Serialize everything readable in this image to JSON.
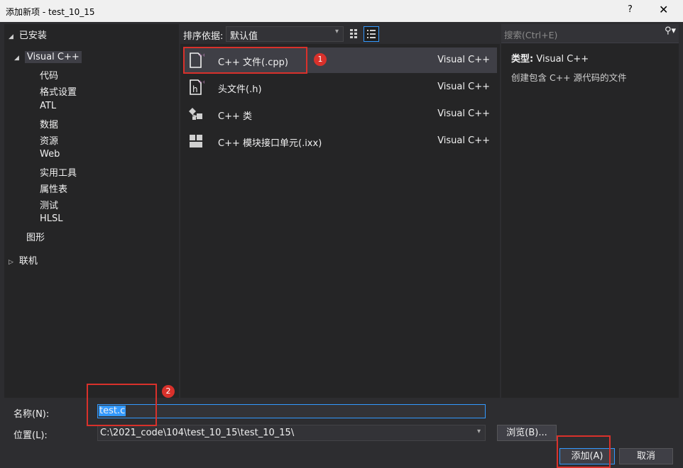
{
  "window": {
    "title": "添加新项 - test_10_15",
    "help_label": "?",
    "close_label": "✕"
  },
  "sidebar": {
    "installed_label": "已安装",
    "root_label": "Visual C++",
    "children": [
      "代码",
      "格式设置",
      "ATL",
      "数据",
      "资源",
      "Web",
      "实用工具",
      "属性表",
      "测试",
      "HLSL"
    ],
    "graphics_label": "图形",
    "online_label": "联机"
  },
  "sort": {
    "label": "排序依据:",
    "value": "默认值"
  },
  "templates": [
    {
      "name": "C++ 文件(.cpp)",
      "lang": "Visual C++",
      "icon": "cpp-file-icon"
    },
    {
      "name": "头文件(.h)",
      "lang": "Visual C++",
      "icon": "header-file-icon"
    },
    {
      "name": "C++ 类",
      "lang": "Visual C++",
      "icon": "cpp-class-icon"
    },
    {
      "name": "C++ 模块接口单元(.ixx)",
      "lang": "Visual C++",
      "icon": "module-unit-icon"
    }
  ],
  "details": {
    "search_placeholder": "搜索(Ctrl+E)",
    "type_label": "类型:",
    "type_value": "Visual C++",
    "description": "创建包含 C++ 源代码的文件"
  },
  "form": {
    "name_label": "名称(N):",
    "name_value": "test.c",
    "location_label": "位置(L):",
    "location_value": "C:\\2021_code\\104\\test_10_15\\test_10_15\\",
    "browse_label": "浏览(B)...",
    "add_label": "添加(A)",
    "cancel_label": "取消"
  },
  "annotations": {
    "badge1": "1",
    "badge2": "2"
  },
  "colors": {
    "accent": "#3399ff",
    "highlight_red": "#d9312b",
    "background": "#2d2d30",
    "panel": "#252526"
  }
}
